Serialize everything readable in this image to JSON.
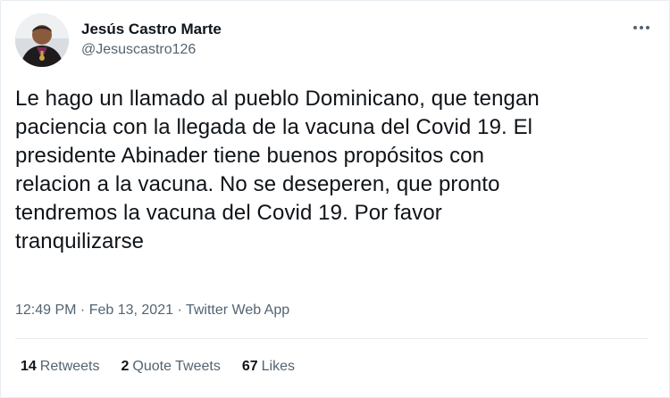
{
  "author": {
    "display_name": "Jesús Castro Marte",
    "handle": "@Jesuscastro126"
  },
  "more_icon": "more-horizontal-icon",
  "tweet": {
    "text": "Le hago un llamado al pueblo Dominicano, que tengan\npaciencia con la llegada de la vacuna del Covid 19. El\npresidente Abinader  tiene buenos propósitos con\nrelacion a la vacuna. No se deseperen, que pronto\ntendremos la vacuna del Covid 19. Por favor\ntranquilizarse",
    "time": "12:49 PM",
    "date": "Feb 13, 2021",
    "source": "Twitter Web App",
    "separator": " · "
  },
  "stats": {
    "retweets_count": "14",
    "retweets_label": "Retweets",
    "quote_count": "2",
    "quote_label": "Quote Tweets",
    "likes_count": "67",
    "likes_label": "Likes"
  },
  "colors": {
    "text": "#0f1419",
    "secondary": "#536471",
    "divider": "#e6ecf0"
  }
}
